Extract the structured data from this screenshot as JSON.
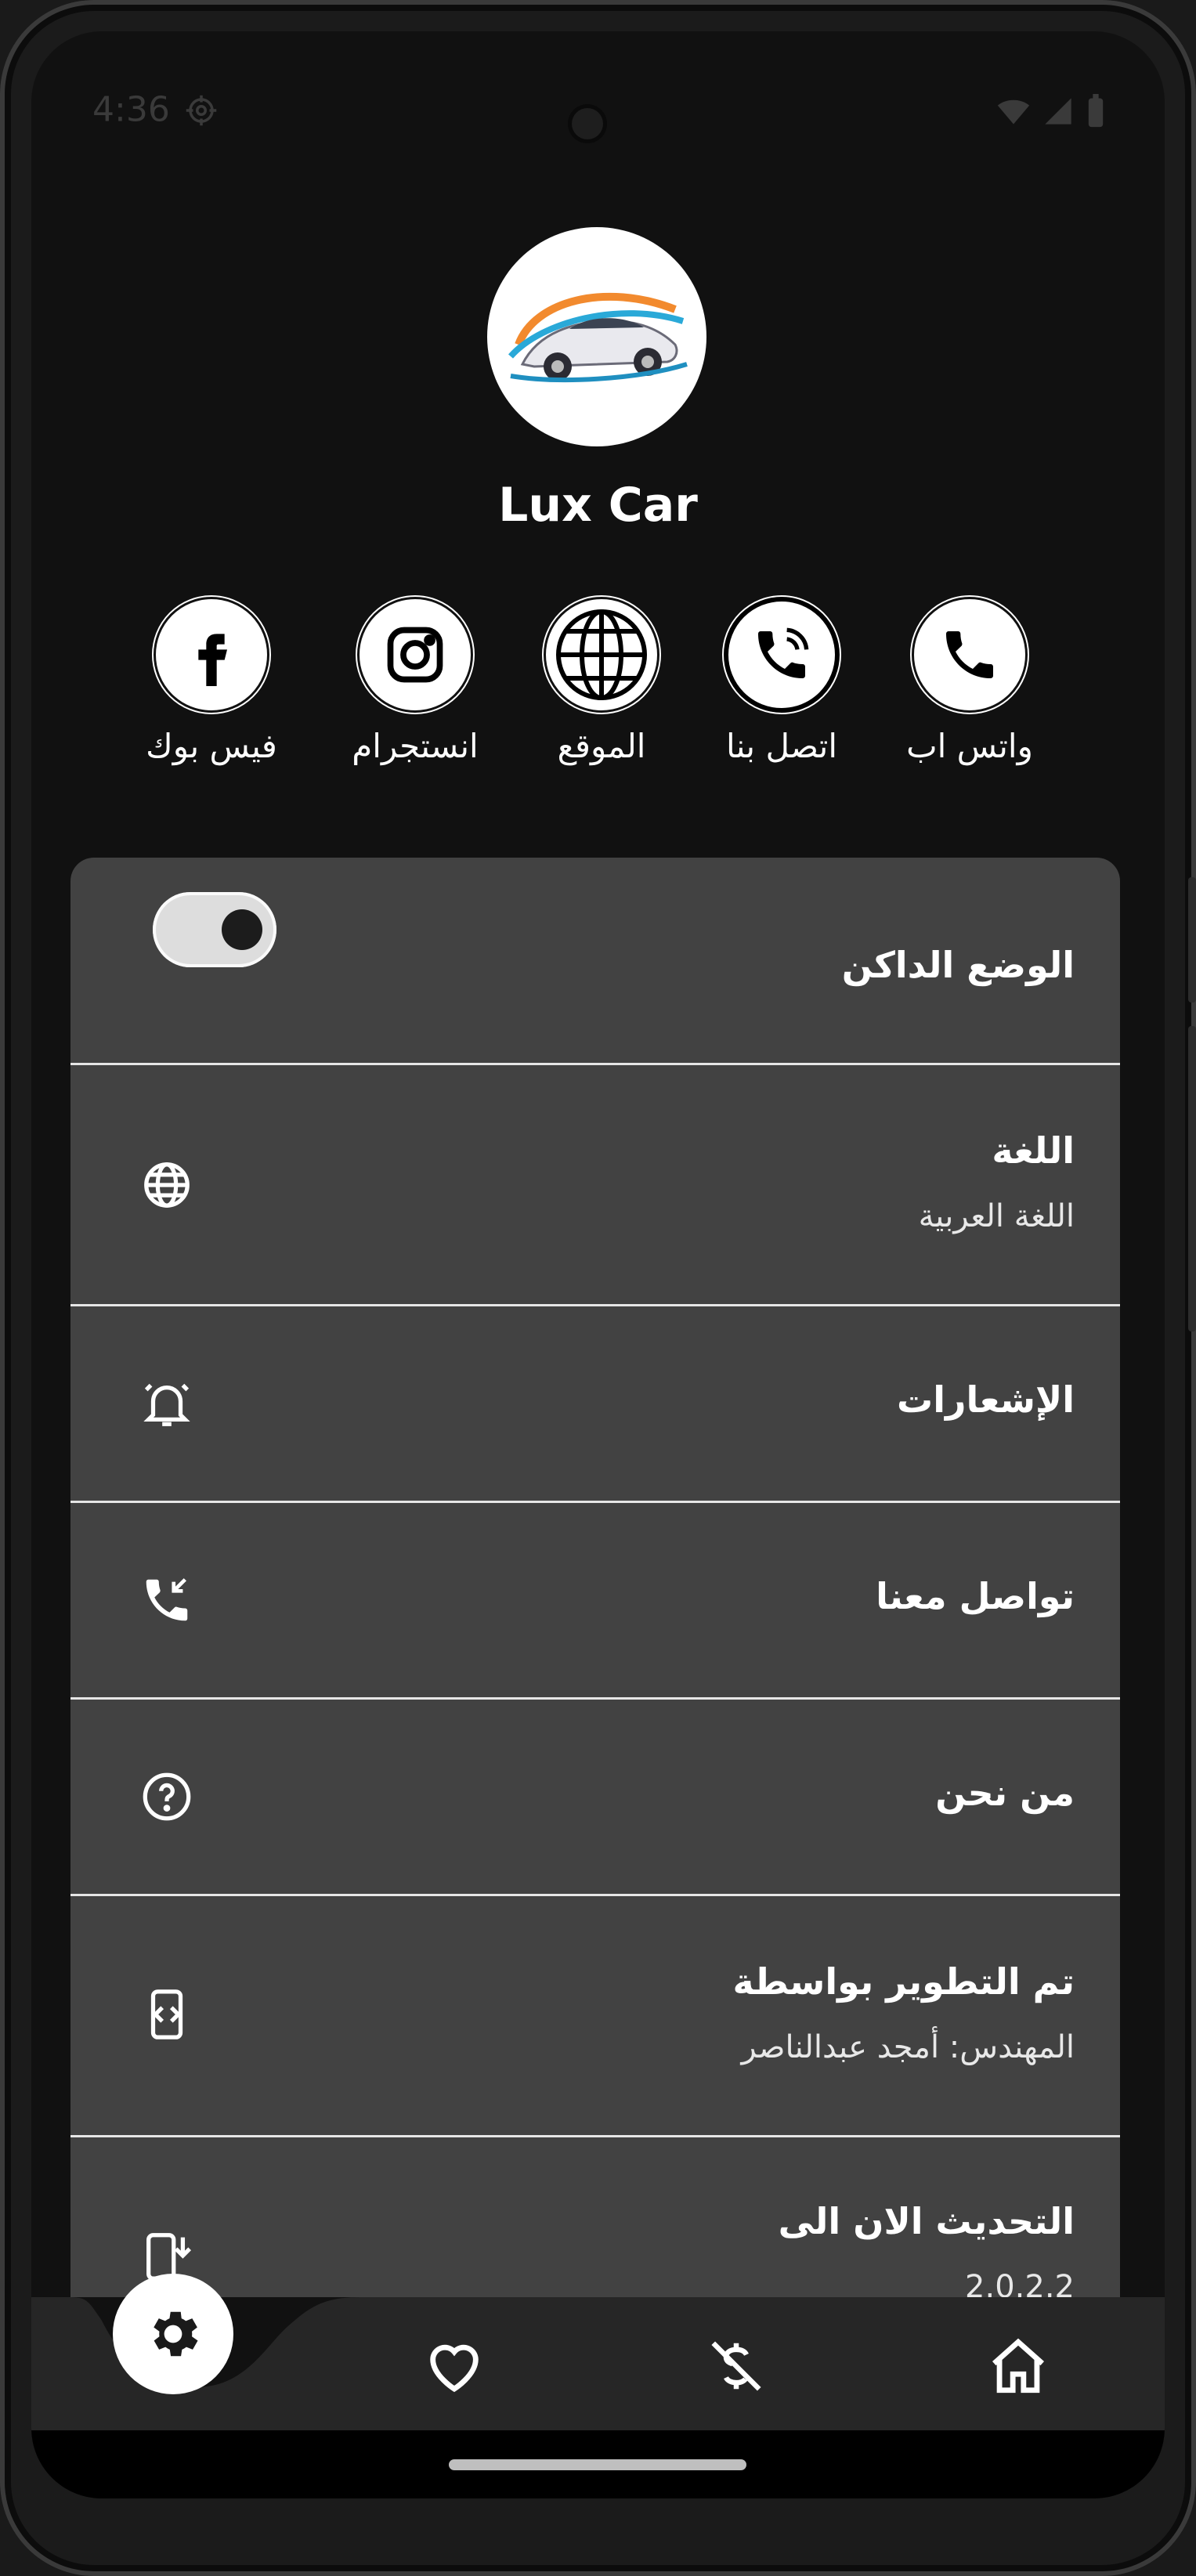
{
  "status_bar": {
    "time": "4:36"
  },
  "app": {
    "name": "Lux Car"
  },
  "social_links": [
    {
      "label": "فيس بوك",
      "icon": "facebook-icon"
    },
    {
      "label": "انستجرام",
      "icon": "instagram-icon"
    },
    {
      "label": "الموقع",
      "icon": "globe-icon"
    },
    {
      "label": "اتصل بنا",
      "icon": "phone-call-icon"
    },
    {
      "label": "واتس اب",
      "icon": "phone-icon"
    }
  ],
  "settings": {
    "dark_mode": {
      "title": "الوضع الداكن",
      "enabled": true
    },
    "language": {
      "title": "اللغة",
      "value": "اللغة العربية",
      "icon": "globe-icon"
    },
    "notifications": {
      "title": "الإشعارات",
      "icon": "bell-icon"
    },
    "contact": {
      "title": "تواصل معنا",
      "icon": "phone-incoming-icon"
    },
    "about": {
      "title": "من نحن",
      "icon": "help-circle-icon"
    },
    "developer": {
      "title": "تم التطوير بواسطة",
      "value": "المهندس: أمجد عبدالناصر",
      "icon": "code-icon"
    },
    "update": {
      "title": "التحديث الان الى",
      "value": "2.0.2.2",
      "icon": "mobile-download-icon"
    }
  },
  "bottom_nav": [
    {
      "name": "settings",
      "icon": "gear-icon",
      "active": true
    },
    {
      "name": "favorites",
      "icon": "heart-icon"
    },
    {
      "name": "offers",
      "icon": "dollar-off-icon"
    },
    {
      "name": "home",
      "icon": "home-icon"
    }
  ],
  "colors": {
    "background": "#111111",
    "card": "#424242",
    "divider": "#e6e6e6",
    "navbar": "#262626"
  }
}
